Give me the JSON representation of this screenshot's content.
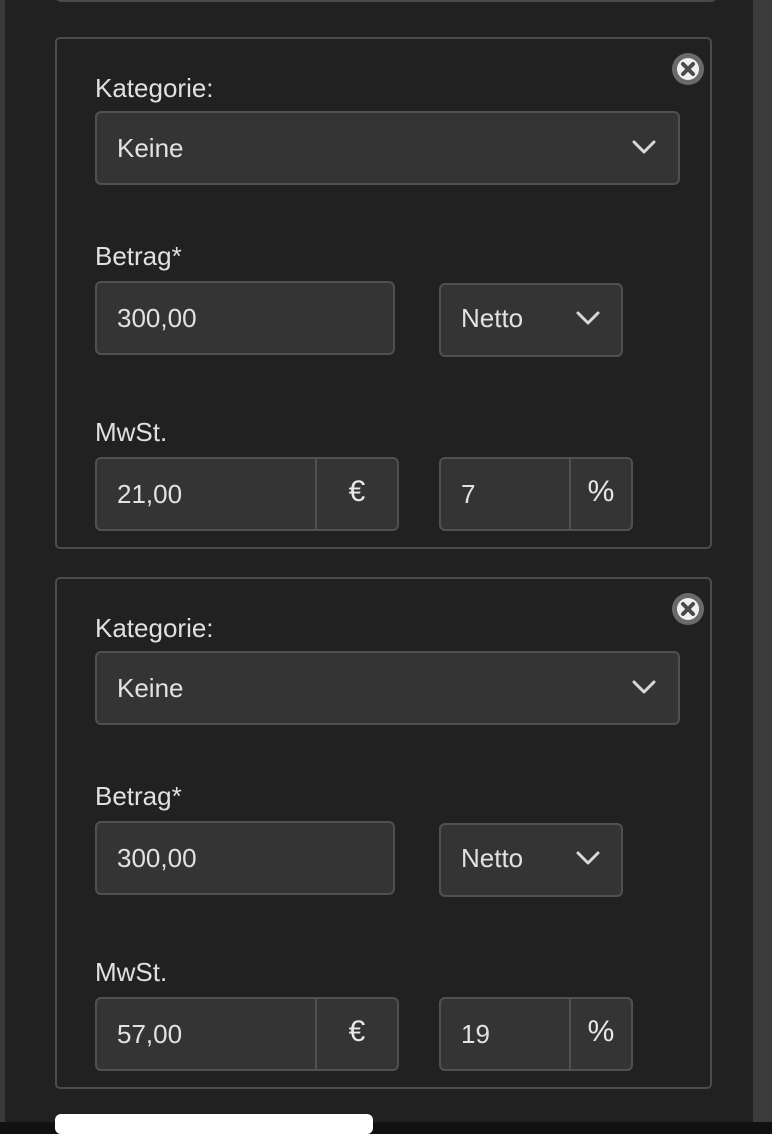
{
  "items": [
    {
      "kategorie_label": "Kategorie:",
      "kategorie_value": "Keine",
      "betrag_label": "Betrag*",
      "betrag_value": "300,00",
      "betrag_type": "Netto",
      "mwst_label": "MwSt.",
      "mwst_amount": "21,00",
      "currency_symbol": "€",
      "mwst_rate": "7",
      "percent_symbol": "%"
    },
    {
      "kategorie_label": "Kategorie:",
      "kategorie_value": "Keine",
      "betrag_label": "Betrag*",
      "betrag_value": "300,00",
      "betrag_type": "Netto",
      "mwst_label": "MwSt.",
      "mwst_amount": "57,00",
      "currency_symbol": "€",
      "mwst_rate": "19",
      "percent_symbol": "%"
    }
  ],
  "icons": {
    "close": "close-circle-icon",
    "dropdown": "chevron-down-icon"
  },
  "colors": {
    "panel_background": "#212121",
    "field_background": "#343434",
    "border": "#505050",
    "text": "#e2e2e2"
  }
}
